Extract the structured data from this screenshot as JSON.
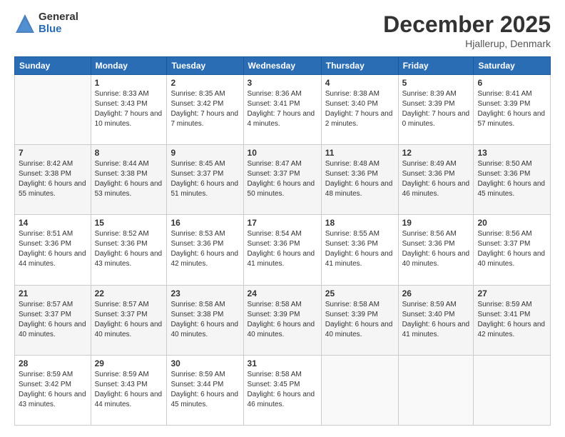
{
  "logo": {
    "general": "General",
    "blue": "Blue"
  },
  "title": "December 2025",
  "location": "Hjallerup, Denmark",
  "days_of_week": [
    "Sunday",
    "Monday",
    "Tuesday",
    "Wednesday",
    "Thursday",
    "Friday",
    "Saturday"
  ],
  "weeks": [
    [
      {
        "day": "",
        "empty": true
      },
      {
        "day": "1",
        "sunrise": "Sunrise: 8:33 AM",
        "sunset": "Sunset: 3:43 PM",
        "daylight": "Daylight: 7 hours and 10 minutes."
      },
      {
        "day": "2",
        "sunrise": "Sunrise: 8:35 AM",
        "sunset": "Sunset: 3:42 PM",
        "daylight": "Daylight: 7 hours and 7 minutes."
      },
      {
        "day": "3",
        "sunrise": "Sunrise: 8:36 AM",
        "sunset": "Sunset: 3:41 PM",
        "daylight": "Daylight: 7 hours and 4 minutes."
      },
      {
        "day": "4",
        "sunrise": "Sunrise: 8:38 AM",
        "sunset": "Sunset: 3:40 PM",
        "daylight": "Daylight: 7 hours and 2 minutes."
      },
      {
        "day": "5",
        "sunrise": "Sunrise: 8:39 AM",
        "sunset": "Sunset: 3:39 PM",
        "daylight": "Daylight: 7 hours and 0 minutes."
      },
      {
        "day": "6",
        "sunrise": "Sunrise: 8:41 AM",
        "sunset": "Sunset: 3:39 PM",
        "daylight": "Daylight: 6 hours and 57 minutes."
      }
    ],
    [
      {
        "day": "7",
        "sunrise": "Sunrise: 8:42 AM",
        "sunset": "Sunset: 3:38 PM",
        "daylight": "Daylight: 6 hours and 55 minutes."
      },
      {
        "day": "8",
        "sunrise": "Sunrise: 8:44 AM",
        "sunset": "Sunset: 3:38 PM",
        "daylight": "Daylight: 6 hours and 53 minutes."
      },
      {
        "day": "9",
        "sunrise": "Sunrise: 8:45 AM",
        "sunset": "Sunset: 3:37 PM",
        "daylight": "Daylight: 6 hours and 51 minutes."
      },
      {
        "day": "10",
        "sunrise": "Sunrise: 8:47 AM",
        "sunset": "Sunset: 3:37 PM",
        "daylight": "Daylight: 6 hours and 50 minutes."
      },
      {
        "day": "11",
        "sunrise": "Sunrise: 8:48 AM",
        "sunset": "Sunset: 3:36 PM",
        "daylight": "Daylight: 6 hours and 48 minutes."
      },
      {
        "day": "12",
        "sunrise": "Sunrise: 8:49 AM",
        "sunset": "Sunset: 3:36 PM",
        "daylight": "Daylight: 6 hours and 46 minutes."
      },
      {
        "day": "13",
        "sunrise": "Sunrise: 8:50 AM",
        "sunset": "Sunset: 3:36 PM",
        "daylight": "Daylight: 6 hours and 45 minutes."
      }
    ],
    [
      {
        "day": "14",
        "sunrise": "Sunrise: 8:51 AM",
        "sunset": "Sunset: 3:36 PM",
        "daylight": "Daylight: 6 hours and 44 minutes."
      },
      {
        "day": "15",
        "sunrise": "Sunrise: 8:52 AM",
        "sunset": "Sunset: 3:36 PM",
        "daylight": "Daylight: 6 hours and 43 minutes."
      },
      {
        "day": "16",
        "sunrise": "Sunrise: 8:53 AM",
        "sunset": "Sunset: 3:36 PM",
        "daylight": "Daylight: 6 hours and 42 minutes."
      },
      {
        "day": "17",
        "sunrise": "Sunrise: 8:54 AM",
        "sunset": "Sunset: 3:36 PM",
        "daylight": "Daylight: 6 hours and 41 minutes."
      },
      {
        "day": "18",
        "sunrise": "Sunrise: 8:55 AM",
        "sunset": "Sunset: 3:36 PM",
        "daylight": "Daylight: 6 hours and 41 minutes."
      },
      {
        "day": "19",
        "sunrise": "Sunrise: 8:56 AM",
        "sunset": "Sunset: 3:36 PM",
        "daylight": "Daylight: 6 hours and 40 minutes."
      },
      {
        "day": "20",
        "sunrise": "Sunrise: 8:56 AM",
        "sunset": "Sunset: 3:37 PM",
        "daylight": "Daylight: 6 hours and 40 minutes."
      }
    ],
    [
      {
        "day": "21",
        "sunrise": "Sunrise: 8:57 AM",
        "sunset": "Sunset: 3:37 PM",
        "daylight": "Daylight: 6 hours and 40 minutes."
      },
      {
        "day": "22",
        "sunrise": "Sunrise: 8:57 AM",
        "sunset": "Sunset: 3:37 PM",
        "daylight": "Daylight: 6 hours and 40 minutes."
      },
      {
        "day": "23",
        "sunrise": "Sunrise: 8:58 AM",
        "sunset": "Sunset: 3:38 PM",
        "daylight": "Daylight: 6 hours and 40 minutes."
      },
      {
        "day": "24",
        "sunrise": "Sunrise: 8:58 AM",
        "sunset": "Sunset: 3:39 PM",
        "daylight": "Daylight: 6 hours and 40 minutes."
      },
      {
        "day": "25",
        "sunrise": "Sunrise: 8:58 AM",
        "sunset": "Sunset: 3:39 PM",
        "daylight": "Daylight: 6 hours and 40 minutes."
      },
      {
        "day": "26",
        "sunrise": "Sunrise: 8:59 AM",
        "sunset": "Sunset: 3:40 PM",
        "daylight": "Daylight: 6 hours and 41 minutes."
      },
      {
        "day": "27",
        "sunrise": "Sunrise: 8:59 AM",
        "sunset": "Sunset: 3:41 PM",
        "daylight": "Daylight: 6 hours and 42 minutes."
      }
    ],
    [
      {
        "day": "28",
        "sunrise": "Sunrise: 8:59 AM",
        "sunset": "Sunset: 3:42 PM",
        "daylight": "Daylight: 6 hours and 43 minutes."
      },
      {
        "day": "29",
        "sunrise": "Sunrise: 8:59 AM",
        "sunset": "Sunset: 3:43 PM",
        "daylight": "Daylight: 6 hours and 44 minutes."
      },
      {
        "day": "30",
        "sunrise": "Sunrise: 8:59 AM",
        "sunset": "Sunset: 3:44 PM",
        "daylight": "Daylight: 6 hours and 45 minutes."
      },
      {
        "day": "31",
        "sunrise": "Sunrise: 8:58 AM",
        "sunset": "Sunset: 3:45 PM",
        "daylight": "Daylight: 6 hours and 46 minutes."
      },
      {
        "day": "",
        "empty": true
      },
      {
        "day": "",
        "empty": true
      },
      {
        "day": "",
        "empty": true
      }
    ]
  ]
}
